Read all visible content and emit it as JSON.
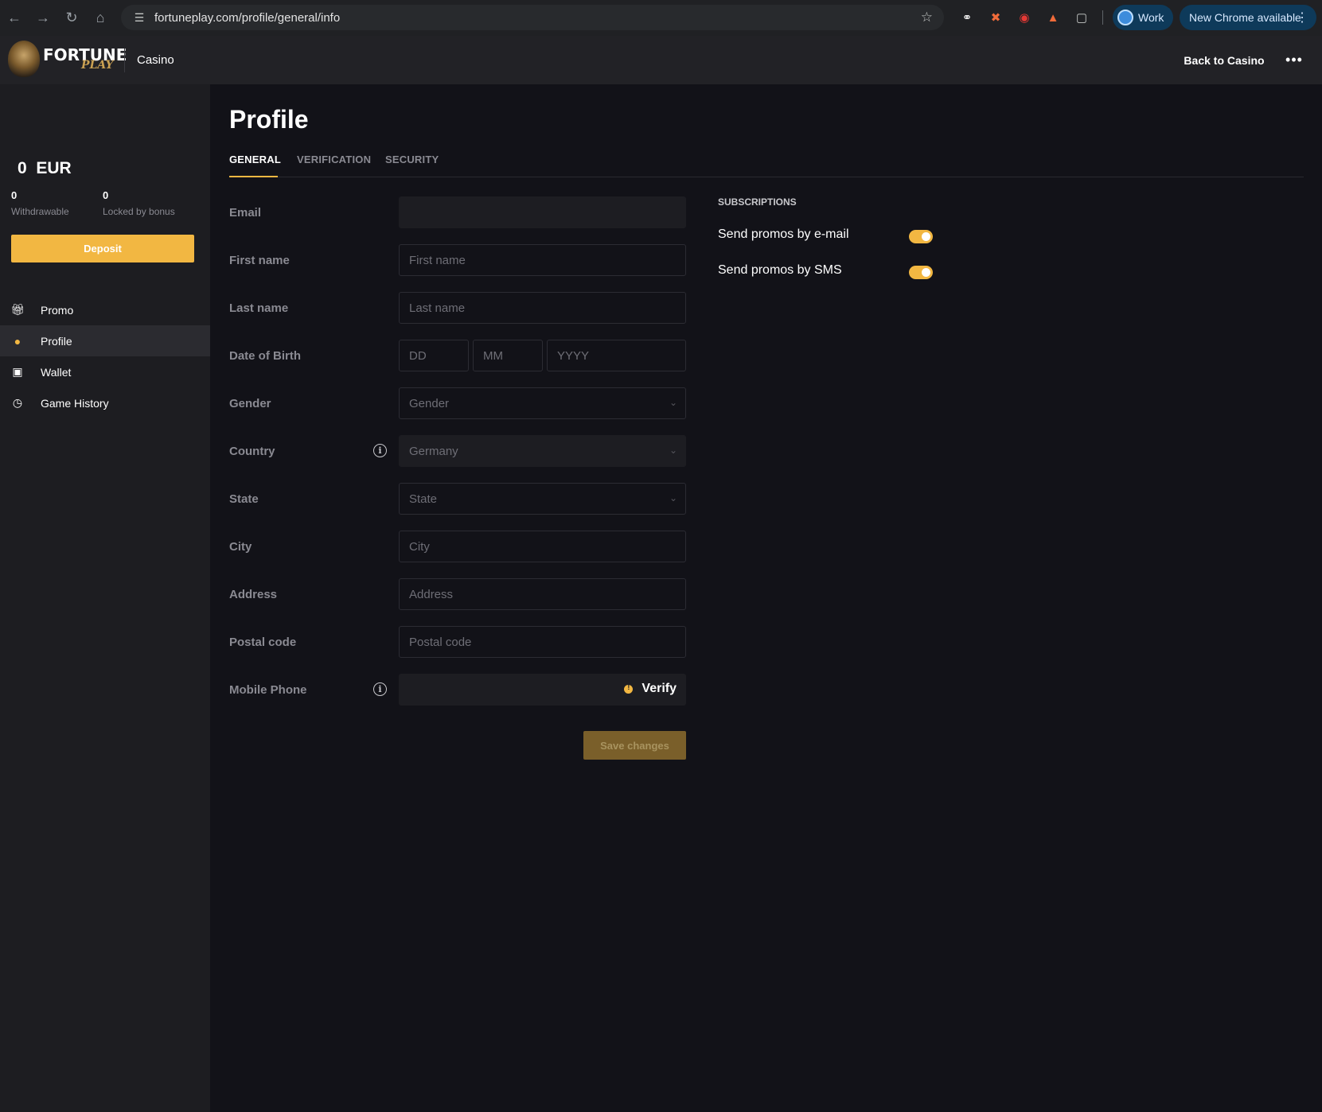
{
  "browser": {
    "url": "fortuneplay.com/profile/general/info",
    "profile_label": "Work",
    "update_label": "New Chrome available"
  },
  "header": {
    "logo_main": "FORTUNE",
    "logo_sub": "PLAY",
    "section": "Casino",
    "back_label": "Back to Casino"
  },
  "sidebar": {
    "balance": "0  EUR",
    "withdrawable_value": "0",
    "withdrawable_label": "Withdrawable",
    "locked_value": "0",
    "locked_label": "Locked by bonus",
    "deposit_label": "Deposit",
    "items": [
      {
        "label": "Promo",
        "icon": "gift-icon"
      },
      {
        "label": "Profile",
        "icon": "user-icon"
      },
      {
        "label": "Wallet",
        "icon": "wallet-icon"
      },
      {
        "label": "Game History",
        "icon": "clock-icon"
      }
    ]
  },
  "page": {
    "title": "Profile",
    "tabs": [
      "GENERAL",
      "VERIFICATION",
      "SECURITY"
    ],
    "active_tab": "GENERAL"
  },
  "form": {
    "email_label": "Email",
    "email_value": "",
    "first_name_label": "First name",
    "first_name_placeholder": "First name",
    "last_name_label": "Last name",
    "last_name_placeholder": "Last name",
    "dob_label": "Date of Birth",
    "dob_day_placeholder": "DD",
    "dob_month_placeholder": "MM",
    "dob_year_placeholder": "YYYY",
    "gender_label": "Gender",
    "gender_value": "Gender",
    "country_label": "Country",
    "country_value": "Germany",
    "state_label": "State",
    "state_value": "State",
    "city_label": "City",
    "city_placeholder": "City",
    "address_label": "Address",
    "address_placeholder": "Address",
    "postal_label": "Postal code",
    "postal_placeholder": "Postal code",
    "phone_label": "Mobile Phone",
    "verify_label": "Verify",
    "save_label": "Save changes"
  },
  "subscriptions": {
    "title": "SUBSCRIPTIONS",
    "email_label": "Send promos by e-mail",
    "email_on": true,
    "sms_label": "Send promos by SMS",
    "sms_on": true
  },
  "colors": {
    "accent": "#f2b742",
    "background": "#121218",
    "sidebar": "#1d1d21"
  }
}
